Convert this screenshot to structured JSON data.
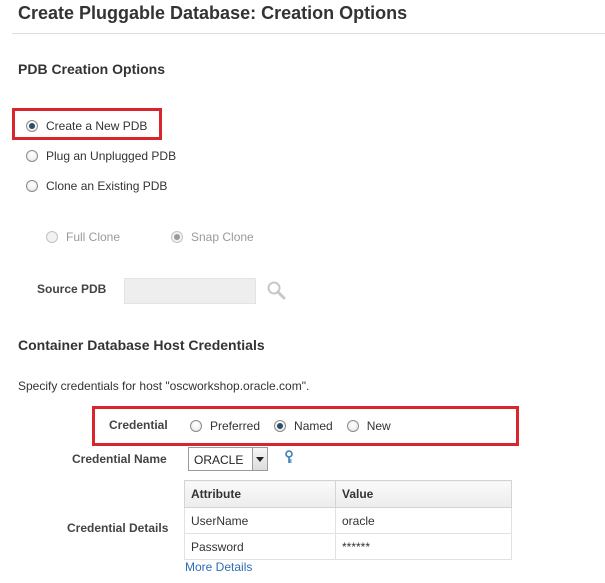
{
  "page_title": "Create Pluggable Database: Creation Options",
  "pdb_section": {
    "heading": "PDB Creation Options",
    "options": [
      {
        "label": "Create a New PDB",
        "checked": true
      },
      {
        "label": "Plug an Unplugged PDB",
        "checked": false
      },
      {
        "label": "Clone an Existing PDB",
        "checked": false
      }
    ],
    "clone_types": [
      {
        "label": "Full Clone",
        "checked": false,
        "disabled": true
      },
      {
        "label": "Snap Clone",
        "checked": true,
        "disabled": true
      }
    ],
    "source_pdb_label": "Source PDB",
    "source_pdb_value": ""
  },
  "cred_section": {
    "heading": "Container Database Host Credentials",
    "description": "Specify credentials for host \"oscworkshop.oracle.com\".",
    "credential_label": "Credential",
    "credential_options": [
      {
        "label": "Preferred",
        "checked": false
      },
      {
        "label": "Named",
        "checked": true
      },
      {
        "label": "New",
        "checked": false
      }
    ],
    "credential_name_label": "Credential Name",
    "credential_name_value": "ORACLE",
    "details_label": "Credential Details",
    "table": {
      "headers": [
        "Attribute",
        "Value"
      ],
      "rows": [
        [
          "UserName",
          "oracle"
        ],
        [
          "Password",
          "******"
        ]
      ]
    },
    "more_details": "More Details"
  },
  "colors": {
    "highlight": "#d9262d",
    "link": "#2d6eb3",
    "radio_dot": "#2a4d6e"
  },
  "icons": {
    "search": "search-icon",
    "key": "key-icon",
    "dropdown": "chevron-down-icon"
  }
}
